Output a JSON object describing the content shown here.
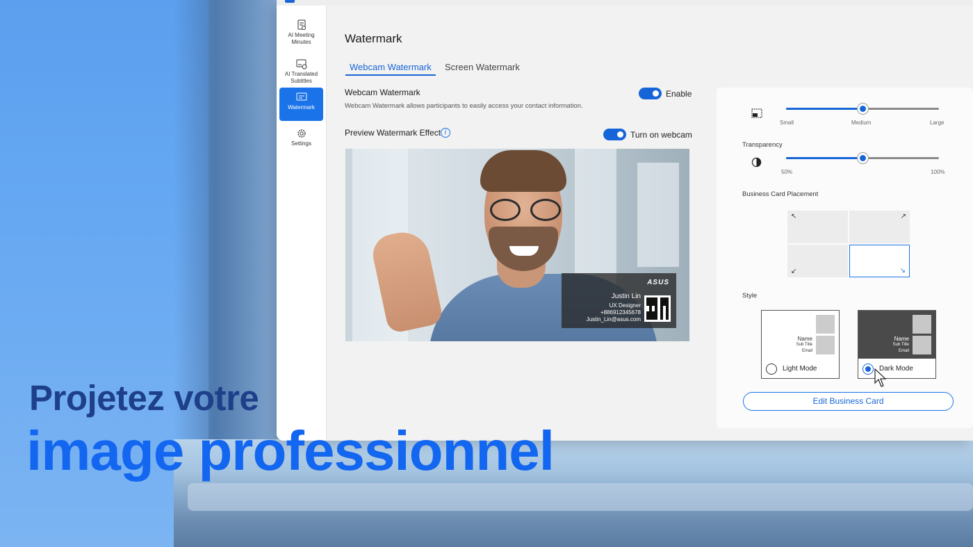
{
  "sidebar": {
    "items": [
      {
        "label": "AI Meeting Minutes",
        "icon": "document-icon"
      },
      {
        "label": "AI Translated Subtitles",
        "icon": "subtitle-icon"
      },
      {
        "label": "Watermark",
        "icon": "watermark-icon",
        "active": true
      },
      {
        "label": "Settings",
        "icon": "gear-icon"
      }
    ]
  },
  "main": {
    "title": "Watermark",
    "tabs": [
      {
        "label": "Webcam Watermark",
        "active": true
      },
      {
        "label": "Screen Watermark",
        "active": false
      }
    ],
    "webcam_section": {
      "title": "Webcam Watermark",
      "description": "Webcam Watermark allows participants to easily access your contact information.",
      "toggle_label": "Enable",
      "toggle_on": true
    },
    "preview_section": {
      "title": "Preview Watermark Effect",
      "toggle_label": "Turn on webcam",
      "toggle_on": true
    },
    "card_overlay": {
      "brand": "ASUS",
      "name": "Justin Lin",
      "title": "UX Designer",
      "phone": "+886912345678",
      "email": "Justin_Lin@asus.com"
    }
  },
  "panel": {
    "size": {
      "icon": "resize-icon",
      "ticks": [
        "Small",
        "Medium",
        "Large"
      ],
      "value": 0.5
    },
    "transparency": {
      "label": "Transparency",
      "icon": "contrast-icon",
      "ticks": [
        "50%",
        "100%"
      ],
      "value": 0.5
    },
    "placement": {
      "label": "Business Card Placement",
      "arrows": [
        "↖",
        "↗",
        "↙",
        "↘"
      ],
      "selected": "bottom-right"
    },
    "style": {
      "label": "Style",
      "mini_name": "Name",
      "mini_subtitle": "Sub Title",
      "mini_email": "Email",
      "options": [
        {
          "label": "Light Mode",
          "selected": false
        },
        {
          "label": "Dark Mode",
          "selected": true
        }
      ]
    },
    "edit_button": "Edit Business Card"
  },
  "overlay_text": {
    "line1": "Projetez votre",
    "line2": "image professionnel"
  },
  "colors": {
    "accent": "#1565d8",
    "headline_dark": "#1e3f8a",
    "headline_blue": "#1366f0"
  }
}
